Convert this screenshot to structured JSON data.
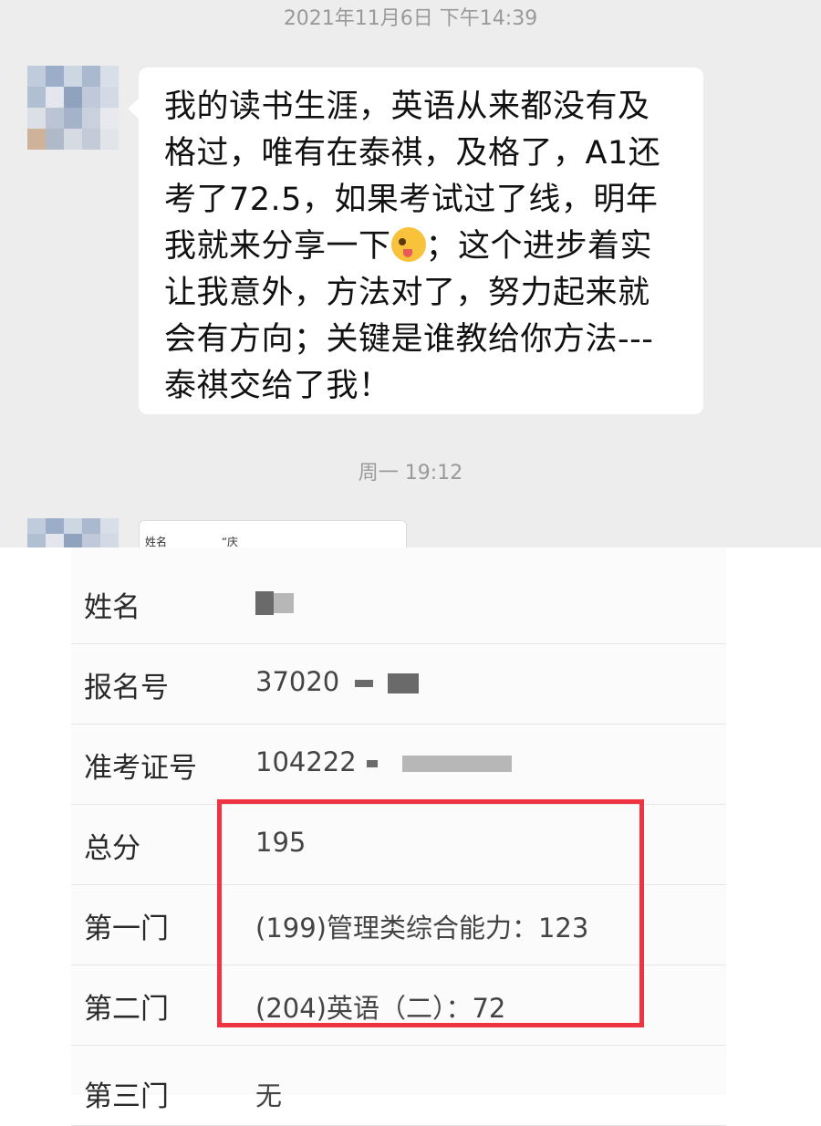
{
  "chat": {
    "timestamp_1": "2021年11月6日 下午14:39",
    "message_part1": "我的读书生涯，英语从来都没有及格过，唯有在泰祺，及格了，A1还考了72.5，如果考试过了线，明年我就来分享一下",
    "emoji": "winking-tongue-emoji",
    "message_part2": "；这个进步着实让我意外，方法对了，努力起来就会有方向；关键是谁教给你方法---泰祺交给了我！",
    "timestamp_2": "周一 19:12",
    "preview_label": "姓名",
    "preview_value": "“庆"
  },
  "results": {
    "rows": [
      {
        "label": "姓名",
        "value": ""
      },
      {
        "label": "报名号",
        "value": "37020"
      },
      {
        "label": "准考证号",
        "value": "104222"
      },
      {
        "label": "总分",
        "value": "195"
      },
      {
        "label": "第一门",
        "value": "(199)管理类综合能力：123"
      },
      {
        "label": "第二门",
        "value": "(204)英语（二）：72"
      },
      {
        "label": "第三门",
        "value": "无"
      }
    ]
  },
  "colors": {
    "highlight_border": "#ee3440",
    "chat_background": "#ededed"
  }
}
